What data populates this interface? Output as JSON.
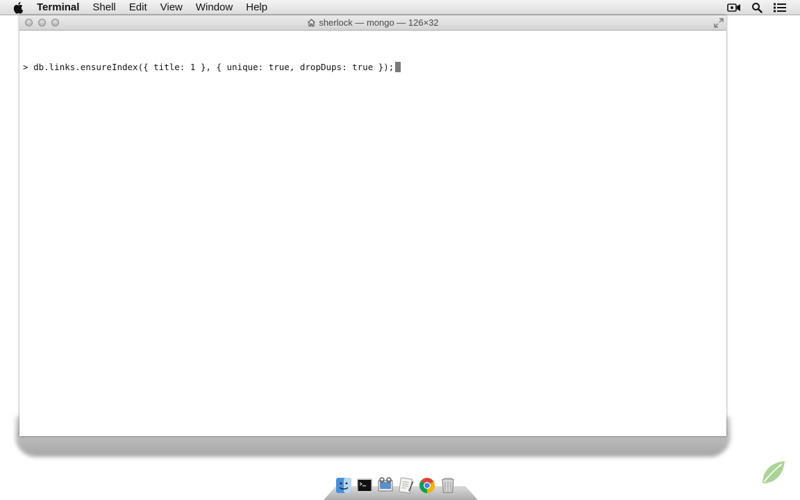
{
  "menubar": {
    "app_name": "Terminal",
    "items": [
      "Shell",
      "Edit",
      "View",
      "Window",
      "Help"
    ],
    "status_icons": [
      "video-camera-icon",
      "search-icon",
      "list-icon"
    ]
  },
  "window": {
    "title": "sherlock — mongo — 126×32"
  },
  "terminal": {
    "prompt": ">",
    "command": "db.links.ensureIndex({ title: 1 }, { unique: true, dropDups: true });"
  },
  "dock": {
    "icons": [
      "finder-icon",
      "terminal-icon",
      "preview-icon",
      "textedit-icon",
      "chrome-icon",
      "trash-icon"
    ]
  },
  "colors": {
    "cursor": "#7a7a7a",
    "watermark": "#8fc07a"
  }
}
